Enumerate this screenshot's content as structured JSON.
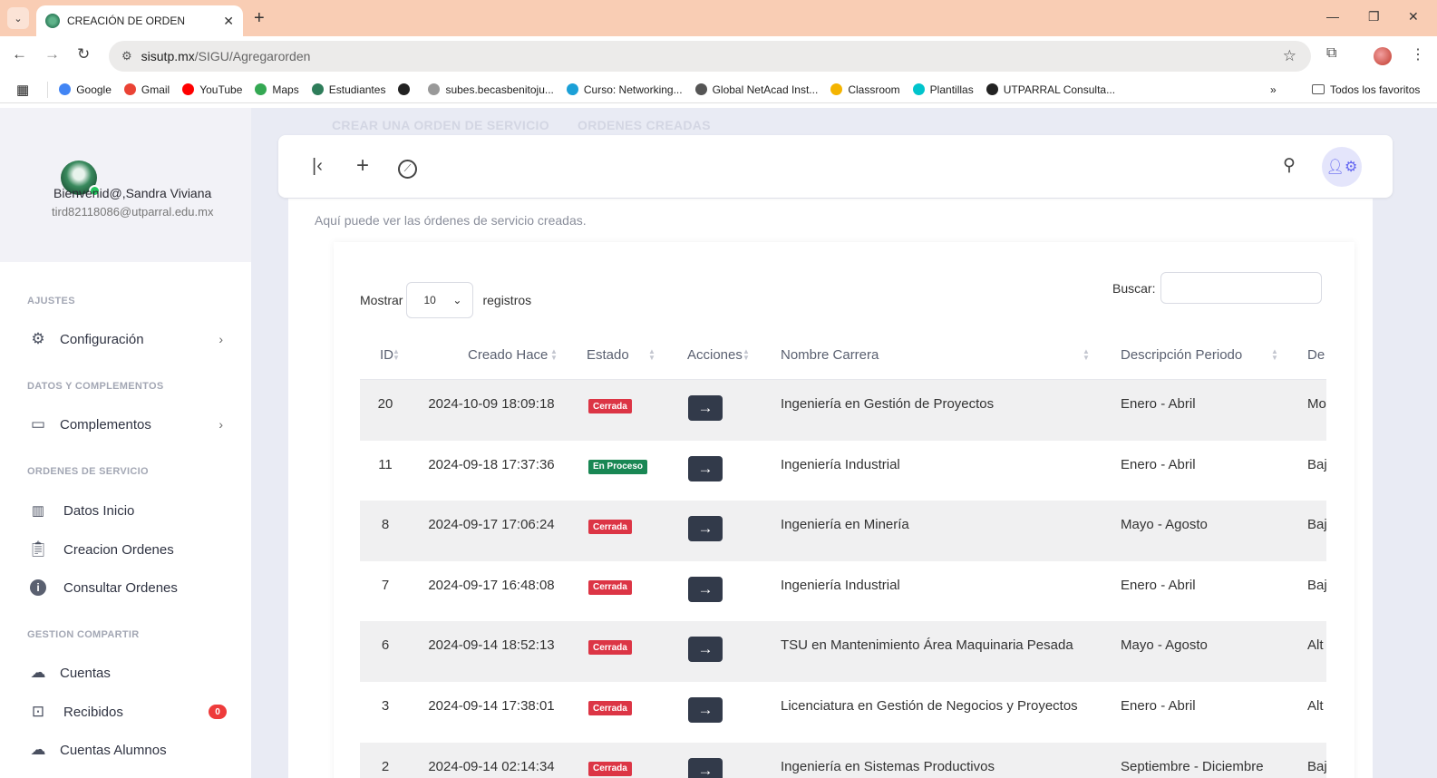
{
  "browser": {
    "tab_title": "CREACIÓN DE ORDEN",
    "url_host": "sisutp.mx",
    "url_path": "/SIGU/Agregarorden",
    "bookmarks": [
      {
        "label": "Google",
        "icon": "google-icon",
        "color": "#4285f4"
      },
      {
        "label": "Gmail",
        "icon": "gmail-icon",
        "color": "#ea4335"
      },
      {
        "label": "YouTube",
        "icon": "youtube-icon",
        "color": "#ff0000"
      },
      {
        "label": "Maps",
        "icon": "maps-icon",
        "color": "#34a853"
      },
      {
        "label": "Estudiantes",
        "icon": "utp-icon",
        "color": "#2e7d5a"
      },
      {
        "label": "",
        "icon": "globe-icon",
        "color": "#222222"
      },
      {
        "label": "subes.becasbenitoju...",
        "icon": "seal-icon",
        "color": "#999999"
      },
      {
        "label": "Curso: Networking...",
        "icon": "cisco-icon",
        "color": "#1ba0d7"
      },
      {
        "label": "Global NetAcad Inst...",
        "icon": "cisco-icon",
        "color": "#555555"
      },
      {
        "label": "Classroom",
        "icon": "classroom-icon",
        "color": "#f4b400"
      },
      {
        "label": "Plantillas",
        "icon": "canva-icon",
        "color": "#00c4cc"
      },
      {
        "label": "UTPARRAL Consulta...",
        "icon": "globe-icon",
        "color": "#222222"
      }
    ],
    "all_bookmarks": "Todos los favoritos"
  },
  "sidebar": {
    "welcome": "Bienvenid@,Sandra Viviana",
    "email": "tird82118086@utparral.edu.mx",
    "sections": {
      "ajustes": "AJUSTES",
      "datos": "DATOS Y COMPLEMENTOS",
      "ordenes": "ORDENES DE SERVICIO",
      "gestion": "GESTION COMPARTIR"
    },
    "items": {
      "configuracion": "Configuración",
      "complementos": "Complementos",
      "datos_inicio": "Datos Inicio",
      "creacion_ordenes": "Creacion Ordenes",
      "consultar_ordenes": "Consultar Ordenes",
      "cuentas": "Cuentas",
      "recibidos": "Recibidos",
      "recibidos_count": "0",
      "cuentas_alumnos": "Cuentas Alumnos"
    }
  },
  "main": {
    "tab_crear": "CREAR UNA ORDEN DE SERVICIO",
    "tab_creadas": "ORDENES CREADAS",
    "subtitle": "Aquí puede ver las órdenes de servicio creadas.",
    "show_label": "Mostrar",
    "show_value": "10",
    "records_label": "registros",
    "search_label": "Buscar:",
    "columns": [
      "ID",
      "Creado Hace",
      "Estado",
      "Acciones",
      "Nombre Carrera",
      "Descripción Periodo",
      "De"
    ],
    "status_colors": {
      "Cerrada": "#dc3545",
      "En Proceso": "#198754"
    },
    "rows": [
      {
        "id": "20",
        "created": "2024-10-09 18:09:18",
        "status": "Cerrada",
        "career": "Ingeniería en Gestión de Proyectos",
        "period": "Enero - Abril",
        "extra": "Mo"
      },
      {
        "id": "11",
        "created": "2024-09-18 17:37:36",
        "status": "En Proceso",
        "career": "Ingeniería Industrial",
        "period": "Enero - Abril",
        "extra": "Baj"
      },
      {
        "id": "8",
        "created": "2024-09-17 17:06:24",
        "status": "Cerrada",
        "career": "Ingeniería en Minería",
        "period": "Mayo - Agosto",
        "extra": "Baj"
      },
      {
        "id": "7",
        "created": "2024-09-17 16:48:08",
        "status": "Cerrada",
        "career": "Ingeniería Industrial",
        "period": "Enero - Abril",
        "extra": "Baj"
      },
      {
        "id": "6",
        "created": "2024-09-14 18:52:13",
        "status": "Cerrada",
        "career": "TSU en Mantenimiento Área Maquinaria Pesada",
        "period": "Mayo - Agosto",
        "extra": "Alt"
      },
      {
        "id": "3",
        "created": "2024-09-14 17:38:01",
        "status": "Cerrada",
        "career": "Licenciatura en Gestión de Negocios y Proyectos",
        "period": "Enero - Abril",
        "extra": "Alt"
      },
      {
        "id": "2",
        "created": "2024-09-14 02:14:34",
        "status": "Cerrada",
        "career": "Ingeniería en Sistemas Productivos",
        "period": "Septiembre - Diciembre",
        "extra": "Baj"
      }
    ]
  }
}
